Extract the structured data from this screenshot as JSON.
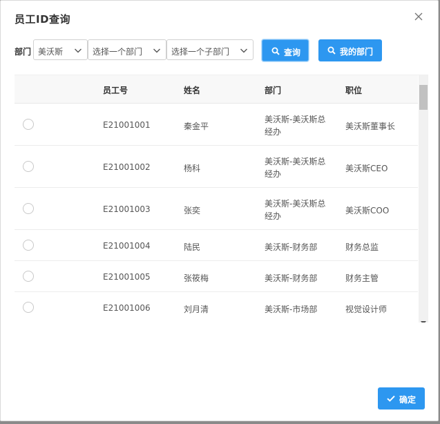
{
  "dialog": {
    "title": "员工ID查询"
  },
  "filters": {
    "label": "部门",
    "company": "美沃斯",
    "dept_placeholder": "选择一个部门",
    "subdept_placeholder": "选择一个子部门",
    "search_label": "查询",
    "my_dept_label": "我的部门"
  },
  "table": {
    "headers": {
      "id": "员工号",
      "name": "姓名",
      "dept": "部门",
      "position": "职位"
    },
    "rows": [
      {
        "id": "E21001001",
        "name": "秦金平",
        "dept_line1": "美沃斯-美沃斯总",
        "dept_line2": "经办",
        "position": "美沃斯董事长"
      },
      {
        "id": "E21001002",
        "name": "杨科",
        "dept_line1": "美沃斯-美沃斯总",
        "dept_line2": "经办",
        "position": "美沃斯CEO"
      },
      {
        "id": "E21001003",
        "name": "张奕",
        "dept_line1": "美沃斯-美沃斯总",
        "dept_line2": "经办",
        "position": "美沃斯COO"
      },
      {
        "id": "E21001004",
        "name": "陆民",
        "dept_line1": "美沃斯-财务部",
        "dept_line2": "",
        "position": "财务总监"
      },
      {
        "id": "E21001005",
        "name": "张筱梅",
        "dept_line1": "美沃斯-财务部",
        "dept_line2": "",
        "position": "财务主管"
      },
      {
        "id": "E21001006",
        "name": "刘月清",
        "dept_line1": "美沃斯-市场部",
        "dept_line2": "",
        "position": "视觉设计师"
      }
    ]
  },
  "footer": {
    "ok_label": "确定"
  },
  "colors": {
    "primary": "#2d97f0"
  },
  "icons": {
    "close": "close-icon",
    "search": "search-icon",
    "check": "check-icon",
    "chevron": "chevron-down-icon"
  }
}
